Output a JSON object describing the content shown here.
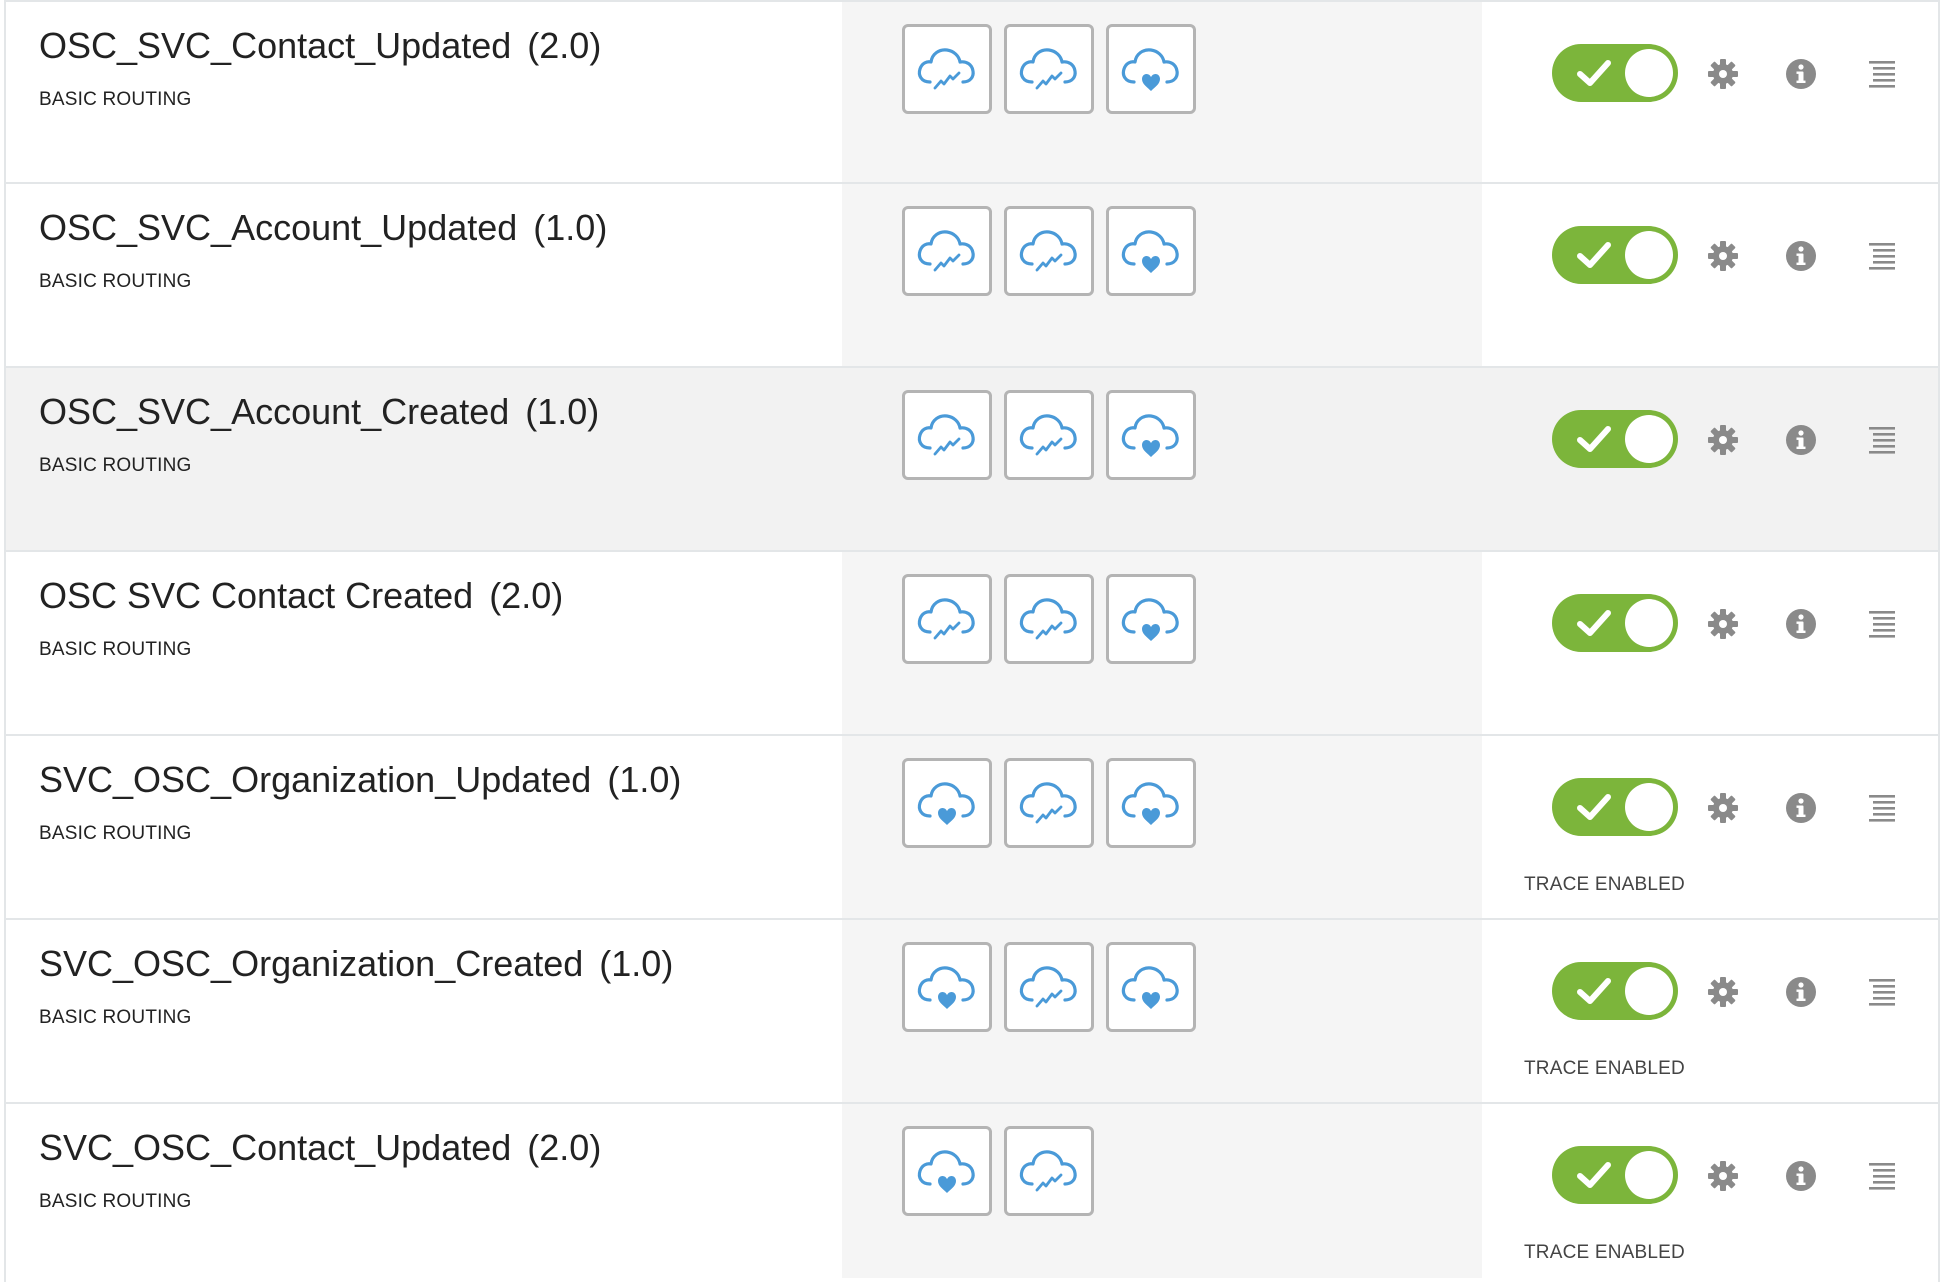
{
  "colors": {
    "toggle_on": "#7cb53b",
    "icon_blue": "#4a9ad8",
    "icon_gray": "#8a8a8a",
    "badge_border": "#b4b4b4"
  },
  "integrations": [
    {
      "name": "OSC_SVC_Contact_Updated",
      "version": "(2.0)",
      "pattern": "BASIC ROUTING",
      "badges": [
        "cloud-trend-icon",
        "cloud-trend-icon",
        "cloud-heart-icon"
      ],
      "active": true,
      "trace": ""
    },
    {
      "name": "OSC_SVC_Account_Updated",
      "version": "(1.0)",
      "pattern": "BASIC ROUTING",
      "badges": [
        "cloud-trend-icon",
        "cloud-trend-icon",
        "cloud-heart-icon"
      ],
      "active": true,
      "trace": ""
    },
    {
      "name": "OSC_SVC_Account_Created",
      "version": "(1.0)",
      "pattern": "BASIC ROUTING",
      "badges": [
        "cloud-trend-icon",
        "cloud-trend-icon",
        "cloud-heart-icon"
      ],
      "active": true,
      "trace": ""
    },
    {
      "name": "OSC SVC Contact Created",
      "version": "(2.0)",
      "pattern": "BASIC ROUTING",
      "badges": [
        "cloud-trend-icon",
        "cloud-trend-icon",
        "cloud-heart-icon"
      ],
      "active": true,
      "trace": ""
    },
    {
      "name": "SVC_OSC_Organization_Updated",
      "version": "(1.0)",
      "pattern": "BASIC ROUTING",
      "badges": [
        "cloud-heart-icon",
        "cloud-trend-icon",
        "cloud-heart-icon"
      ],
      "active": true,
      "trace": "TRACE ENABLED"
    },
    {
      "name": "SVC_OSC_Organization_Created",
      "version": "(1.0)",
      "pattern": "BASIC ROUTING",
      "badges": [
        "cloud-heart-icon",
        "cloud-trend-icon",
        "cloud-heart-icon"
      ],
      "active": true,
      "trace": "TRACE ENABLED"
    },
    {
      "name": "SVC_OSC_Contact_Updated",
      "version": "(2.0)",
      "pattern": "BASIC ROUTING",
      "badges": [
        "cloud-heart-icon",
        "cloud-trend-icon"
      ],
      "active": true,
      "trace": "TRACE ENABLED"
    }
  ]
}
